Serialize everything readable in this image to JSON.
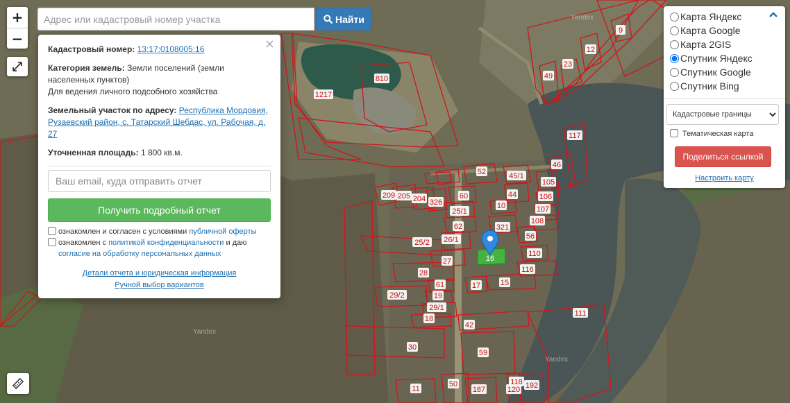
{
  "search": {
    "placeholder": "Адрес или кадастровый номер участка",
    "button_label": "Найти"
  },
  "controls": {
    "zoom_in": "+",
    "zoom_out": "−",
    "fullscreen_icon": "expand-icon",
    "ruler_icon": "ruler-icon"
  },
  "info": {
    "close": "×",
    "cadastral_label": "Кадастровый номер:",
    "cadastral_number": "13:17:0108005:16",
    "category_label": "Категория земель:",
    "category_value": "Земли поселений (земли населенных пунктов)",
    "usage": "Для ведения личного подсобного хозяйства",
    "address_label": "Земельный участок по адресу:",
    "address_value": "Республика Мордовия, Рузаевский район, с. Татарский Шебдас, ул. Рабочая, д. 27",
    "area_label": "Уточненная площадь:",
    "area_value": "1 800 кв.м.",
    "email_placeholder": "Ваш email, куда отправить отчет",
    "report_button": "Получить подробный отчет",
    "agree1_text": "ознакомлен и согласен с условиями ",
    "agree1_link": "публичной оферты",
    "agree2_text": "ознакомлен с ",
    "agree2_link": "политикой конфиденциальности",
    "agree2_mid": " и даю ",
    "agree2_link2": "согласие на обработку персональных данных",
    "details_link": "Детали отчета и юридическая информация",
    "manual_link": "Ручной выбор вариантов"
  },
  "layers": {
    "options": [
      "Карта Яндекс",
      "Карта Google",
      "Карта 2GIS",
      "Спутник Яндекс",
      "Спутник Google",
      "Спутник Bing"
    ],
    "selected_index": 3,
    "collapse_icon": "chevron-up-icon",
    "select_value": "Кадастровые границы",
    "thematic_label": "Тематическая карта",
    "share_button": "Поделиться ссылкой",
    "configure_link": "Настроить карту"
  },
  "map": {
    "watermark": "Yandex",
    "parcel_labels": [
      "810",
      "1217",
      "9",
      "12",
      "23",
      "49",
      "117",
      "46",
      "52",
      "45/1",
      "44",
      "105",
      "106",
      "107",
      "108",
      "10",
      "321",
      "56",
      "110",
      "209",
      "205",
      "204",
      "326",
      "60",
      "25/1",
      "62",
      "26/1",
      "25/2",
      "27",
      "28",
      "61",
      "19",
      "29/2",
      "29/1",
      "18",
      "42",
      "17",
      "15",
      "116",
      "111",
      "30",
      "59",
      "11",
      "50",
      "187",
      "120",
      "118",
      "192",
      "16"
    ],
    "colors": {
      "parcel_border": "#d0161c",
      "label_fill": "#ffffff",
      "label_text": "#c01010",
      "selected_parcel": "#3fbf3f",
      "marker": "#2f89e0",
      "river": "#4a5555"
    }
  }
}
